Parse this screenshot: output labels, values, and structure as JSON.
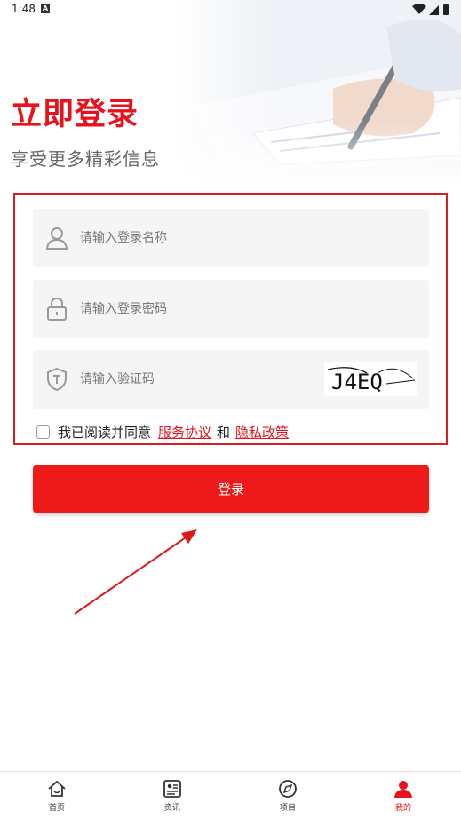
{
  "status_bar": {
    "time": "1:48",
    "notification_glyph": "A"
  },
  "header": {
    "title": "立即登录",
    "subtitle": "享受更多精彩信息"
  },
  "form": {
    "username": {
      "placeholder": "请输入登录名称",
      "value": "",
      "icon": "user-icon"
    },
    "password": {
      "placeholder": "请输入登录密码",
      "value": "",
      "icon": "lock-icon"
    },
    "captcha": {
      "placeholder": "请输入验证码",
      "value": "",
      "icon": "shield-icon",
      "image_text": "J4EQ"
    },
    "agreement": {
      "checked": false,
      "prefix": "我已阅读并同意",
      "terms_link": "服务协议",
      "and": "和",
      "privacy_link": "隐私政策"
    },
    "login_label": "登录"
  },
  "bottom_nav": {
    "items": [
      {
        "label": "首页",
        "icon": "home-icon",
        "active": false
      },
      {
        "label": "资讯",
        "icon": "news-icon",
        "active": false
      },
      {
        "label": "项目",
        "icon": "compass-icon",
        "active": false
      },
      {
        "label": "我的",
        "icon": "person-icon",
        "active": true
      }
    ]
  },
  "colors": {
    "accent": "#e8111c",
    "field_bg": "#f5f5f5",
    "highlight_box": "#d81e1e"
  }
}
